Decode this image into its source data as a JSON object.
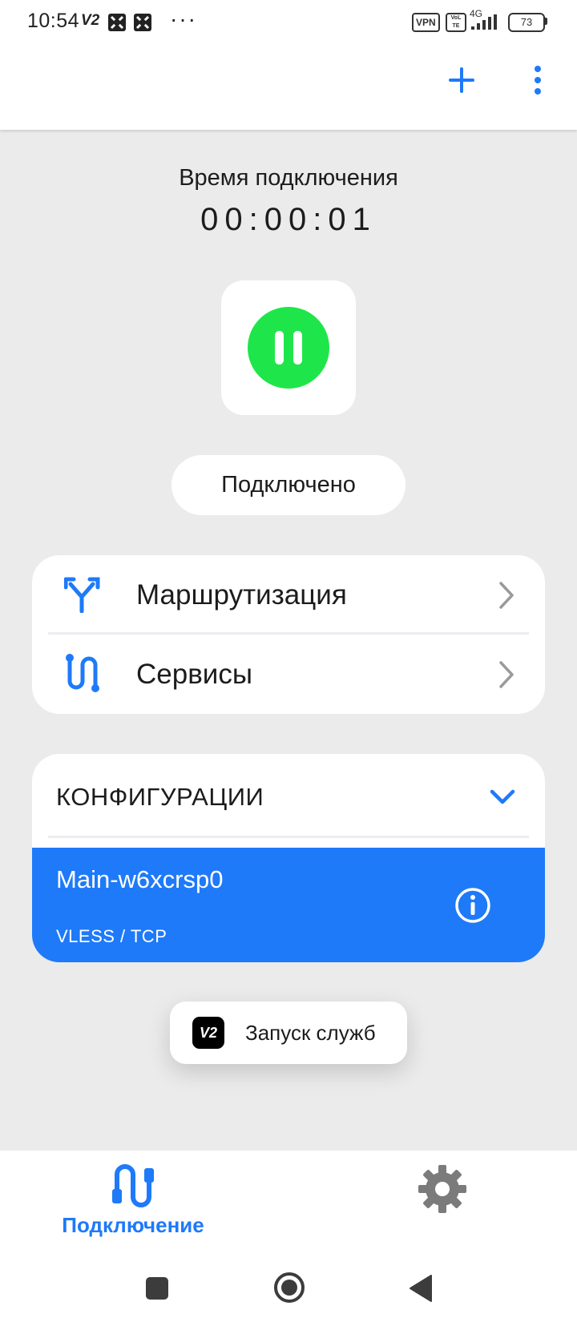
{
  "status_bar": {
    "time": "10:54",
    "v2": "V2",
    "more": "···",
    "vpn_badge": "VPN",
    "volte_badge": "VoLTE",
    "network": "4G",
    "battery": "73"
  },
  "connection": {
    "label": "Время подключения",
    "timer": "00:00:01",
    "status": "Подключено"
  },
  "menu": {
    "routing_label": "Маршрутизация",
    "services_label": "Сервисы"
  },
  "configs": {
    "title": "КОНФИГУРАЦИИ",
    "items": [
      {
        "name": "Main-w6xcrsp0",
        "protocol": "VLESS / TCP"
      }
    ]
  },
  "toast": {
    "logo": "V2",
    "text": "Запуск служб"
  },
  "bottom_nav": {
    "connection_label": "Подключение"
  },
  "colors": {
    "accent": "#1e7af8",
    "connected_green": "#1ee64a",
    "background": "#ebebeb"
  }
}
